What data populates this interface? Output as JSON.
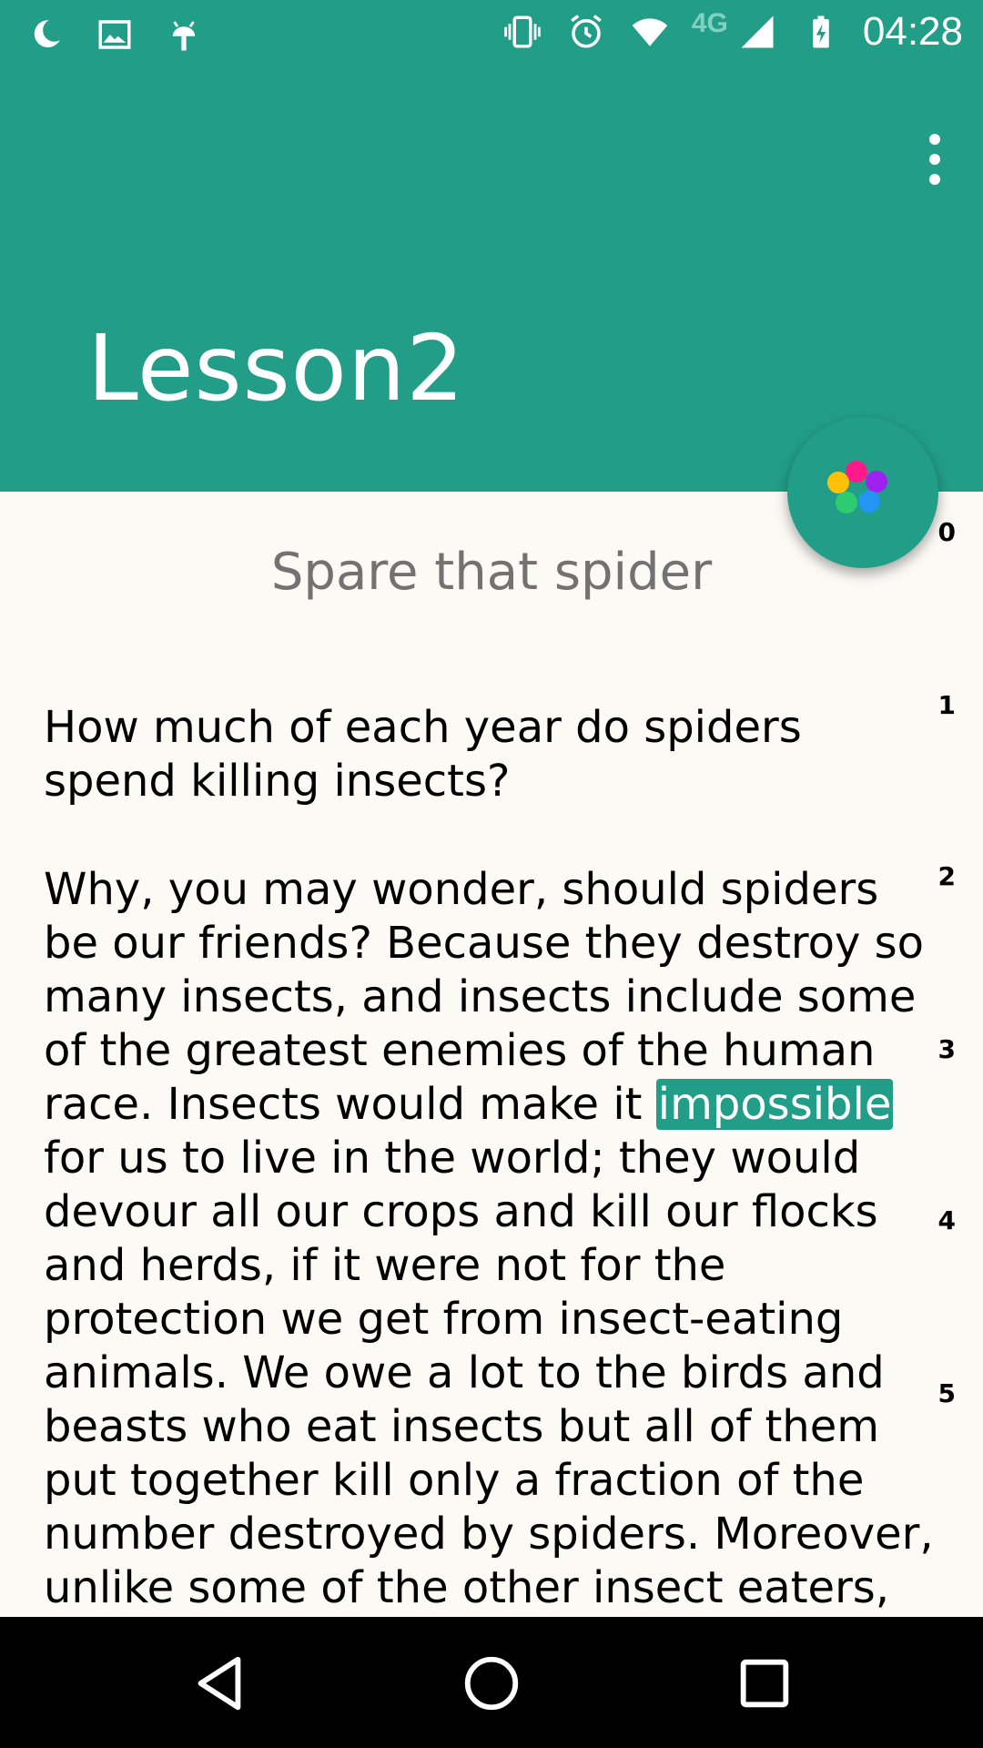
{
  "status_bar": {
    "left_icons": [
      "moon-icon",
      "image-icon",
      "android-debug-icon"
    ],
    "right_icons": [
      "vibrate-icon",
      "alarm-icon",
      "wifi-icon",
      "signal-icon",
      "battery-charging-icon"
    ],
    "network": "4G",
    "time": "04:28"
  },
  "app_bar": {
    "title": "Lesson2",
    "menu_icon": "more-vertical-icon"
  },
  "fab": {
    "icon": "color-palette-icon",
    "dot_colors": [
      "#FF1A8C",
      "#A020F0",
      "#FFC107",
      "#2196F3",
      "#2ECC71"
    ]
  },
  "content": {
    "subtitle": "Spare that spider",
    "paragraph_1": "How much of each year do spiders spend killing insects?",
    "paragraph_2_before": "Why, you may wonder, should spiders be our friends? Because they destroy so many insects, and insects include some of the greatest enemies of the human race. Insects would make it ",
    "highlighted_word": "impossible",
    "paragraph_2_after": " for us to live in the world; they would devour all our crops and kill our flocks and herds, if it were not for the protection we get from insect-eating animals. We owe a lot to the birds and beasts who eat insects but all of them put together kill only a fraction of the number destroyed by spiders. Moreover, unlike some of the other insect eaters, spiders never do the harm to us or our",
    "line_numbers": [
      "0",
      "1",
      "2",
      "3",
      "4",
      "5"
    ]
  },
  "colors": {
    "primary": "#229E88",
    "background": "#FCFAF5"
  },
  "nav_bar": {
    "icons": [
      "back-icon",
      "home-icon",
      "recents-icon"
    ]
  }
}
